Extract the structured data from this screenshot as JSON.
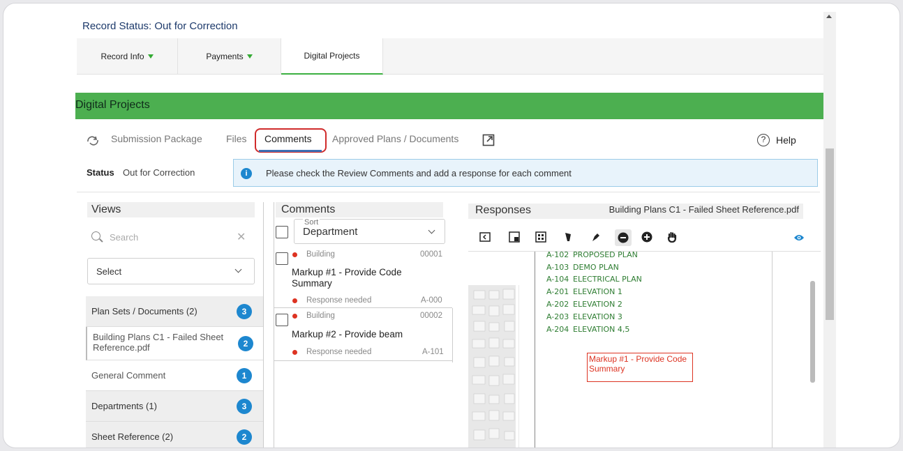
{
  "record": {
    "status": "Record Status: Out for Correction"
  },
  "tabs": [
    {
      "label": "Record Info"
    },
    {
      "label": "Payments"
    },
    {
      "label": "Digital Projects"
    }
  ],
  "section_title": "Digital Projects",
  "subnav": {
    "submission": "Submission Package",
    "files": "Files",
    "comments": "Comments",
    "approved": "Approved Plans / Documents",
    "help": "Help"
  },
  "status": {
    "label": "Status",
    "value": "Out for Correction",
    "info": "Please check the Review Comments and add a response for each comment"
  },
  "views": {
    "title": "Views",
    "search_placeholder": "Search",
    "select_value": "Select",
    "items": [
      {
        "label": "Plan Sets / Documents (2)",
        "count": "3"
      },
      {
        "label": "Building Plans C1 - Failed Sheet Reference.pdf",
        "count": "2"
      },
      {
        "label": "General Comment",
        "count": "1"
      },
      {
        "label": "Departments (1)",
        "count": "3"
      },
      {
        "label": "Sheet Reference (2)",
        "count": "2"
      }
    ]
  },
  "comments": {
    "title": "Comments",
    "sort_label": "Sort",
    "sort_value": "Department",
    "cards": [
      {
        "dept": "Building",
        "id": "00001",
        "text": "Markup #1 - Provide Code Summary",
        "status": "Response needed",
        "sheet": "A-000"
      },
      {
        "dept": "Building",
        "id": "00002",
        "text": "Markup #2 - Provide beam",
        "status": "Response needed",
        "sheet": "A-101"
      }
    ]
  },
  "responses": {
    "title": "Responses",
    "file": "Building Plans C1 - Failed Sheet Reference.pdf",
    "sheets": [
      {
        "code": "A-102",
        "name": "PROPOSED PLAN"
      },
      {
        "code": "A-103",
        "name": "DEMO PLAN"
      },
      {
        "code": "A-104",
        "name": "ELECTRICAL PLAN"
      },
      {
        "code": "A-201",
        "name": "ELEVATION 1"
      },
      {
        "code": "A-202",
        "name": "ELEVATION 2"
      },
      {
        "code": "A-203",
        "name": "ELEVATION 3"
      },
      {
        "code": "A-204",
        "name": "ELEVATION 4,5"
      }
    ],
    "markup": "Markup #1 - Provide Code Summary"
  },
  "colors": {
    "accent_green": "#4caf50",
    "info_blue": "#1d87cf",
    "alert_red": "#d02b2b"
  }
}
